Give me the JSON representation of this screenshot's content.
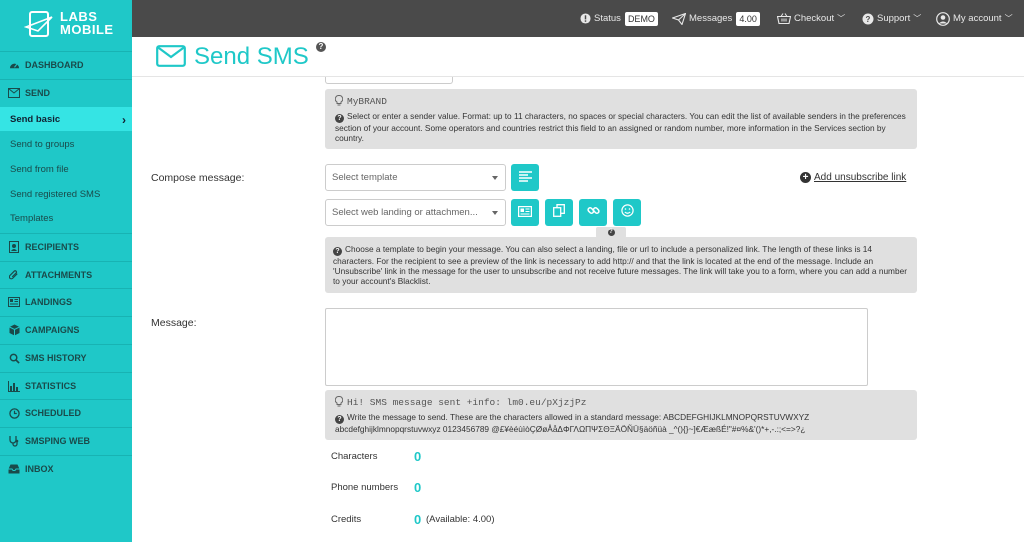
{
  "brand": {
    "logo_line1": "LABS",
    "logo_line2": "MOBILE",
    "accent": "#1fc8c8"
  },
  "sidebar": {
    "items": [
      {
        "label": "DASHBOARD",
        "icon": "dashboard-icon"
      },
      {
        "label": "SEND",
        "icon": "envelope-icon"
      },
      {
        "label": "RECIPIENTS",
        "icon": "contacts-icon"
      },
      {
        "label": "ATTACHMENTS",
        "icon": "paperclip-icon"
      },
      {
        "label": "LANDINGS",
        "icon": "newspaper-icon"
      },
      {
        "label": "CAMPAIGNS",
        "icon": "cube-icon"
      },
      {
        "label": "SMS HISTORY",
        "icon": "search-icon"
      },
      {
        "label": "STATISTICS",
        "icon": "bar-chart-icon"
      },
      {
        "label": "SCHEDULED",
        "icon": "clock-icon"
      },
      {
        "label": "SMSPING WEB",
        "icon": "stethoscope-icon"
      },
      {
        "label": "INBOX",
        "icon": "inbox-icon"
      }
    ],
    "send_sub": [
      "Send basic",
      "Send to groups",
      "Send from file",
      "Send registered SMS",
      "Templates"
    ]
  },
  "topbar": {
    "status_label": "Status",
    "status_value": "DEMO",
    "messages_label": "Messages",
    "messages_value": "4.00",
    "checkout": "Checkout",
    "support": "Support",
    "account": "My account"
  },
  "page": {
    "title": "Send SMS",
    "help": "?"
  },
  "sender": {
    "example": "MyBRAND",
    "help": "Select or enter a sender value. Format: up to 11 characters, no spaces or special characters. You can edit the list of available senders in the preferences section of your account. Some operators and countries restrict this field to an assigned or random number, more information in the Services section by country."
  },
  "compose": {
    "label": "Compose message:",
    "template_placeholder": "Select template",
    "landing_placeholder": "Select web landing or attachmen...",
    "unsubscribe_link": "Add unsubscribe link",
    "tooltip": "?",
    "help": "Choose a template to begin your message. You can also select a landing, file or url to include a personalized link. The length of these links is 14 characters. For the recipient to see a preview of the link is necessary to add http:// and that the link is located at the end of the message. Include an 'Unsubscribe' link in the message for the user to unsubscribe and not receive future messages. The link will take you to a form, where you can add a number to your account's Blacklist."
  },
  "message": {
    "label": "Message:",
    "example": "Hi! SMS message sent +info: lm0.eu/pXjzjPz",
    "help": "Write the message to send. These are the characters allowed in a standard message: ABCDEFGHIJKLMNOPQRSTUVWXYZ abcdefghijklmnopqrstuvwxyz 0123456789 @£¥èéùìòÇØøÅåΔΦΓΛΩΠΨΣΘΞÄÖÑÜ§äöñüà _^(){}~]€ÆæßÉ!\"#¤%&'()*+,-.:;<=>?¿"
  },
  "stats": {
    "characters_label": "Characters",
    "characters_value": "0",
    "phones_label": "Phone numbers",
    "phones_value": "0",
    "credits_label": "Credits",
    "credits_value": "0",
    "available": "(Available: 4.00)"
  }
}
